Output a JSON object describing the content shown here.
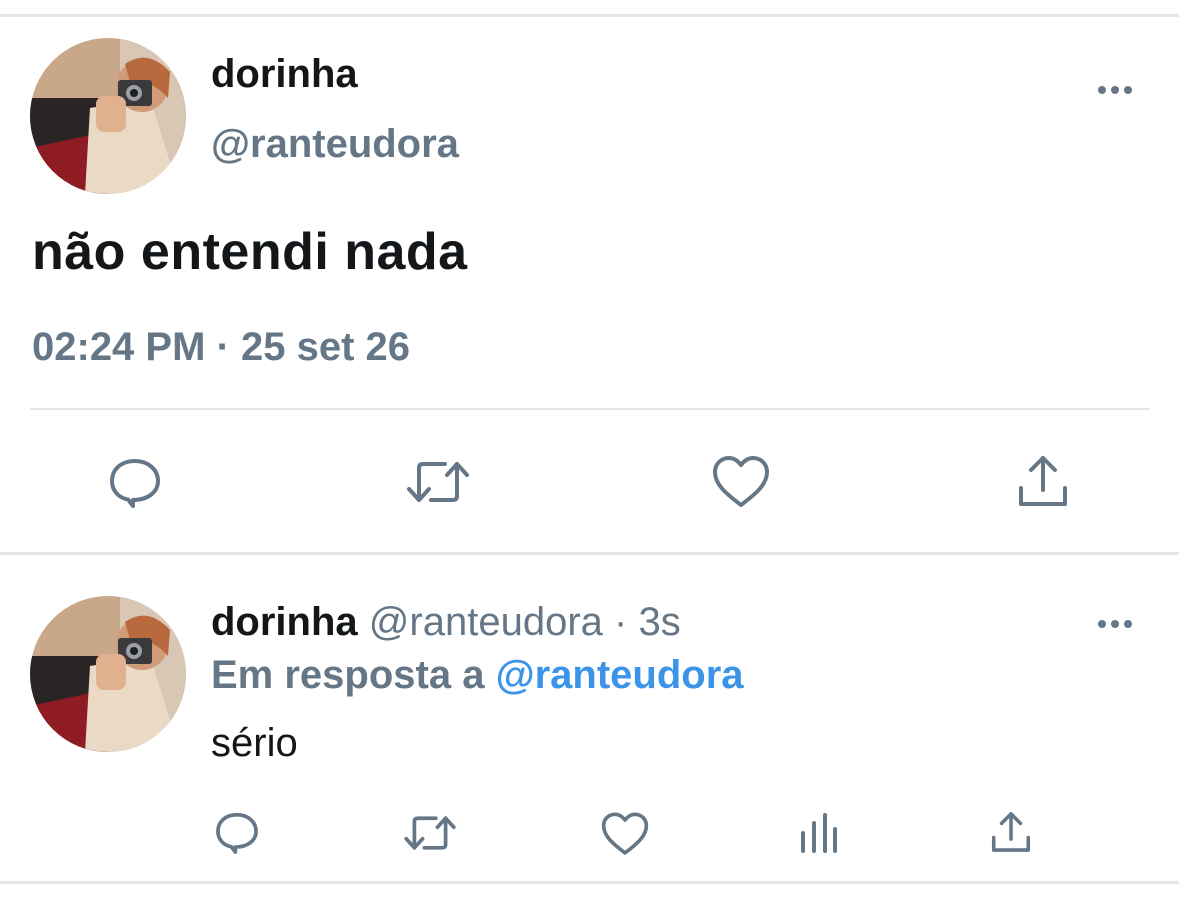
{
  "main_tweet": {
    "display_name": "dorinha",
    "handle": "@ranteudora",
    "text": "não entendi nada",
    "timestamp": "02:24 PM · 25 set 26",
    "actions": [
      "reply-icon",
      "retweet-icon",
      "like-icon",
      "share-icon"
    ]
  },
  "reply_tweet": {
    "display_name": "dorinha",
    "handle": "@ranteudora",
    "separator": "·",
    "time_ago": "3s",
    "reply_to_prefix": "Em resposta a",
    "reply_to_handle": "@ranteudora",
    "text": "sério",
    "actions": [
      "reply-icon",
      "retweet-icon",
      "like-icon",
      "analytics-icon",
      "share-icon"
    ]
  },
  "colors": {
    "text_primary": "#14171a",
    "text_secondary": "#657786",
    "mention": "#3b94e8",
    "divider": "#e4e6e8",
    "icon": "#657786"
  }
}
